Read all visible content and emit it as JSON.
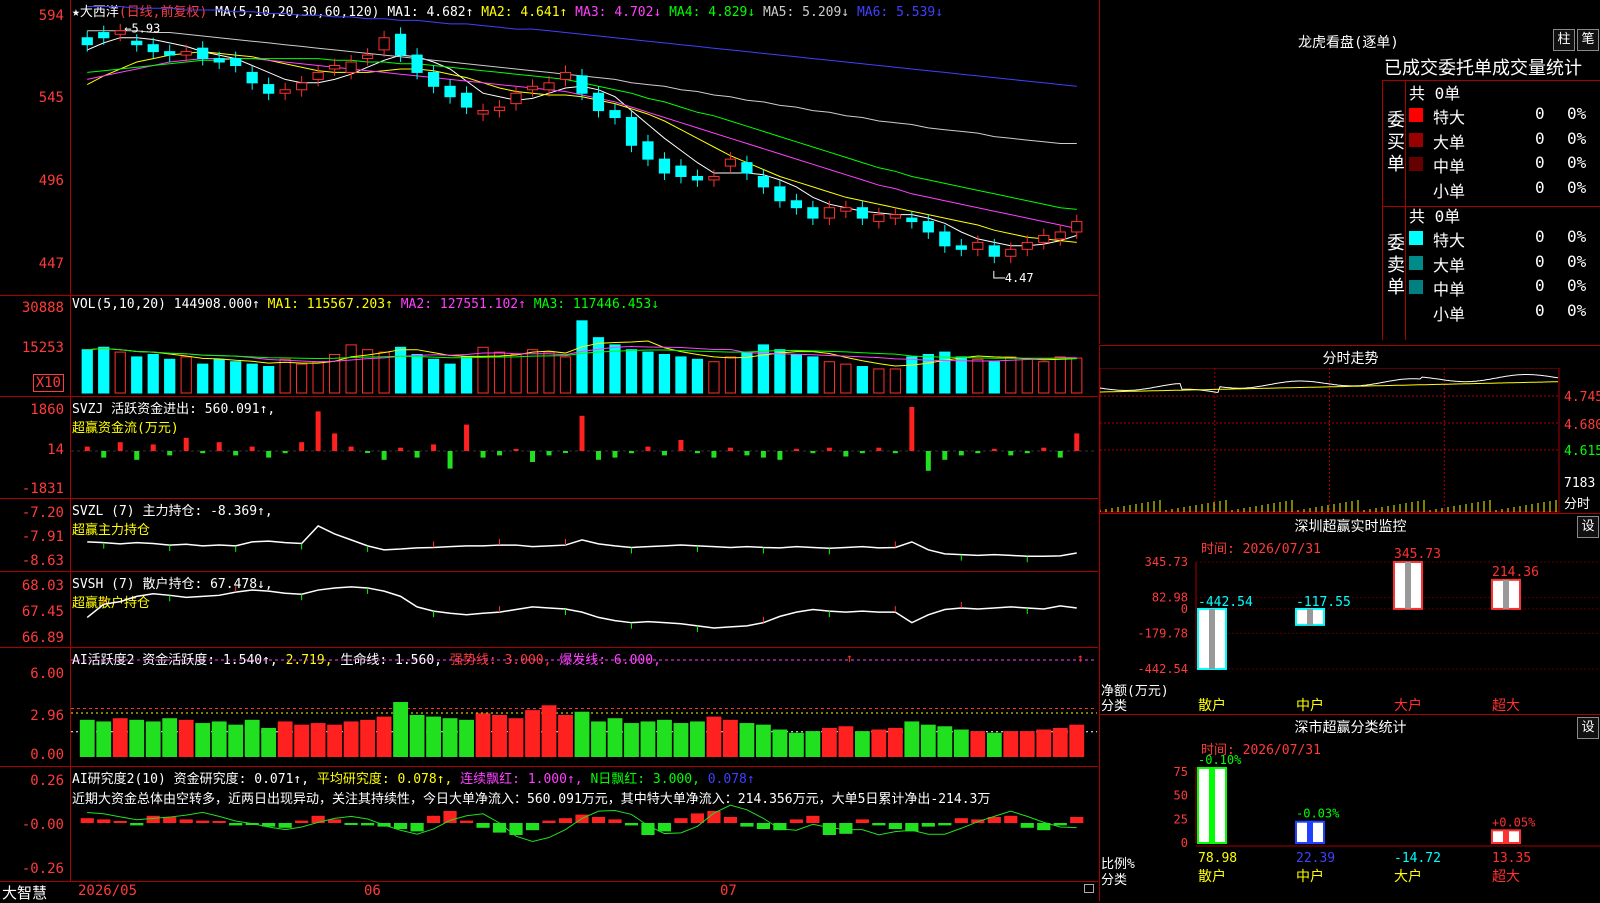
{
  "stock": {
    "name": "★大西洋",
    "period": "(日线,前复权)",
    "ma_label": "MA(5,10,20,30,60,120)",
    "ma_values": [
      {
        "t": "MA1: 4.682↑",
        "c": "#ffffff"
      },
      {
        "t": "MA2: 4.641↑",
        "c": "#ffff00"
      },
      {
        "t": "MA3: 4.702↓",
        "c": "#ff40ff"
      },
      {
        "t": "MA4: 4.829↓",
        "c": "#00ff00"
      },
      {
        "t": "MA5: 5.209↓",
        "c": "#cccccc"
      },
      {
        "t": "MA6: 5.539↓",
        "c": "#4040ff"
      }
    ],
    "high_label": "5.93",
    "low_label": "4.47",
    "axis_ticks": [
      "594",
      "545",
      "496",
      "447"
    ]
  },
  "vol": {
    "label": "VOL(5,10,20)",
    "value": "144908.000↑",
    "ma": [
      {
        "t": "MA1: 115567.203↑",
        "c": "#ffff00"
      },
      {
        "t": "MA2: 127551.102↑",
        "c": "#ff40ff"
      },
      {
        "t": "MA3: 117446.453↓",
        "c": "#00ff00"
      }
    ],
    "axis_ticks": [
      "30888",
      "15253"
    ],
    "unit": "X10"
  },
  "svzj": {
    "line1": "SVZJ  活跃资金进出: 560.091↑,",
    "line2": "超赢资金流(万元)",
    "axis_ticks": [
      "1860",
      "14",
      "-1831"
    ]
  },
  "svzl": {
    "line1": "SVZL (7) 主力持仓: -8.369↑,",
    "line2": "超赢主力持仓",
    "axis_ticks": [
      "-7.20",
      "-7.91",
      "-8.63"
    ]
  },
  "svsh": {
    "line1": "SVSH (7) 散户持仓: 67.478↓,",
    "line2": "超赢散户持仓",
    "axis_ticks": [
      "68.03",
      "67.45",
      "66.89"
    ]
  },
  "ai1": {
    "parts": [
      {
        "t": "AI活跃度2 资金活跃度: 1.540↑,",
        "c": "#ffffff"
      },
      {
        "t": " 2.719,",
        "c": "#ffff00"
      },
      {
        "t": " 生命线: 1.560,",
        "c": "#ffffff"
      },
      {
        "t": " 强势线: 3.000,",
        "c": "#ff3b3b"
      },
      {
        "t": " 爆发线: 6.000,",
        "c": "#ff40ff"
      }
    ],
    "axis_ticks": [
      "6.00",
      "2.96",
      "0.00"
    ]
  },
  "ai2": {
    "parts": [
      {
        "t": "AI研究度2(10) 资金研究度: 0.071↑,",
        "c": "#ffffff"
      },
      {
        "t": " 平均研究度: 0.078↑,",
        "c": "#ffff00"
      },
      {
        "t": " 连续飘红: 1.000↑,",
        "c": "#ff40ff"
      },
      {
        "t": " N日飘红: 3.000,",
        "c": "#00ff00"
      },
      {
        "t": " 0.078↑",
        "c": "#4040ff"
      }
    ],
    "summary": "近期大资金总体由空转多，近两日出现异动，关注其持续性，今日大单净流入：560.091万元，其中特大单净流入：214.356万元，大单5日累计净出-214.3万",
    "axis_ticks": [
      "0.26",
      "-0.00",
      "-0.26"
    ]
  },
  "footer": {
    "brand": "大智慧",
    "dates": [
      "2026/05",
      "06",
      "07"
    ]
  },
  "lhb": {
    "title": "龙虎看盘(逐单)",
    "btn1": "柱",
    "btn2": "笔",
    "header": "已成交委托单成交量统计",
    "buy": {
      "side": "委买单",
      "total": "共 0单",
      "rows": [
        {
          "name": "特大",
          "v": "0",
          "p": "0%",
          "c": "#ff0000"
        },
        {
          "name": "大单",
          "v": "0",
          "p": "0%",
          "c": "#990000"
        },
        {
          "name": "中单",
          "v": "0",
          "p": "0%",
          "c": "#660000"
        },
        {
          "name": "小单",
          "v": "0",
          "p": "0%",
          "c": "#000000"
        }
      ]
    },
    "sell": {
      "side": "委卖单",
      "total": "共 0单",
      "rows": [
        {
          "name": "特大",
          "v": "0",
          "p": "0%",
          "c": "#00ffff"
        },
        {
          "name": "大单",
          "v": "0",
          "p": "0%",
          "c": "#008b8b"
        },
        {
          "name": "中单",
          "v": "0",
          "p": "0%",
          "c": "#008080"
        },
        {
          "name": "小单",
          "v": "0",
          "p": "0%",
          "c": "#000000"
        }
      ]
    }
  },
  "intraday": {
    "title": "分时走势",
    "ticks": [
      "4.745",
      "4.680",
      "4.615"
    ],
    "vol_tick": "7183",
    "unit": "分时"
  },
  "monitor": {
    "title": "深圳超赢实时监控",
    "btn": "设",
    "time": "时间: 2026/07/31",
    "axis_ticks": [
      "345.73",
      "82.98",
      "0",
      "-179.78",
      "-442.54"
    ],
    "unit1": "净额(万元)",
    "unit2": "分类",
    "bars": [
      {
        "cat": "散户",
        "val": -442.54,
        "label": "-442.54",
        "color": "#00ffff",
        "cat_color": "#ffff00",
        "label_color": "#00ffff"
      },
      {
        "cat": "中户",
        "val": -117.55,
        "label": "-117.55",
        "color": "#00ffff",
        "cat_color": "#ffff00",
        "label_color": "#00ffff"
      },
      {
        "cat": "大户",
        "val": 345.73,
        "label": "345.73",
        "color": "#ff3030",
        "cat_color": "#ff3030",
        "label_color": "#ff3030"
      },
      {
        "cat": "超大",
        "val": 214.36,
        "label": "214.36",
        "color": "#ff3030",
        "cat_color": "#ff3030",
        "label_color": "#ff3030"
      }
    ]
  },
  "stats": {
    "title": "深市超赢分类统计",
    "btn": "设",
    "time": "时间: 2026/07/31",
    "axis_ticks": [
      "75",
      "50",
      "25",
      "0"
    ],
    "unit1": "比例%",
    "unit2": "分类",
    "bars": [
      {
        "cat": "散户",
        "val": 78.98,
        "label": "78.98",
        "top": "-0.10%",
        "color": "#00ff00",
        "cat_color": "#ffff00",
        "label_color": "#ffff00",
        "top_color": "#00ff00"
      },
      {
        "cat": "中户",
        "val": 22.39,
        "label": "22.39",
        "top": "-0.03%",
        "color": "#2040ff",
        "cat_color": "#ffff00",
        "label_color": "#4040ff",
        "top_color": "#00ff00"
      },
      {
        "cat": "大户",
        "val": 0,
        "label": "-14.72",
        "top": "",
        "color": "#00ffff",
        "cat_color": "#ffff00",
        "label_color": "#00ffff",
        "top_color": "#00ff00"
      },
      {
        "cat": "超大",
        "val": 13.35,
        "label": "13.35",
        "top": "+0.05%",
        "color": "#ff3030",
        "cat_color": "#ff3030",
        "label_color": "#ff3030",
        "top_color": "#ff3030"
      }
    ]
  },
  "chart_data": {
    "type": "candlestick",
    "title": "大西洋",
    "dates": [
      "2026/05",
      "06",
      "07"
    ],
    "ylim": [
      4.4,
      5.98
    ],
    "open": [
      5.82,
      5.85,
      5.84,
      5.8,
      5.78,
      5.74,
      5.72,
      5.76,
      5.7,
      5.7,
      5.62,
      5.55,
      5.5,
      5.52,
      5.58,
      5.64,
      5.62,
      5.7,
      5.75,
      5.84,
      5.72,
      5.62,
      5.54,
      5.5,
      5.38,
      5.4,
      5.44,
      5.52,
      5.52,
      5.58,
      5.6,
      5.5,
      5.4,
      5.36,
      5.22,
      5.12,
      5.08,
      5.02,
      5.0,
      5.08,
      5.1,
      5.02,
      4.96,
      4.88,
      4.84,
      4.78,
      4.82,
      4.84,
      4.76,
      4.78,
      4.78,
      4.76,
      4.7,
      4.62,
      4.6,
      4.62,
      4.56,
      4.6,
      4.64,
      4.66,
      4.7
    ],
    "close": [
      5.78,
      5.82,
      5.86,
      5.78,
      5.74,
      5.72,
      5.74,
      5.7,
      5.68,
      5.66,
      5.56,
      5.5,
      5.52,
      5.56,
      5.62,
      5.66,
      5.68,
      5.72,
      5.82,
      5.72,
      5.62,
      5.54,
      5.48,
      5.42,
      5.4,
      5.42,
      5.5,
      5.54,
      5.56,
      5.62,
      5.5,
      5.4,
      5.36,
      5.2,
      5.12,
      5.04,
      5.02,
      5.0,
      5.02,
      5.12,
      5.04,
      4.96,
      4.88,
      4.84,
      4.78,
      4.84,
      4.84,
      4.78,
      4.8,
      4.8,
      4.76,
      4.7,
      4.62,
      4.6,
      4.64,
      4.56,
      4.6,
      4.64,
      4.68,
      4.7,
      4.76
    ],
    "series": [
      {
        "name": "MA1",
        "color": "#ffffff",
        "values": [
          5.75,
          5.79,
          5.82,
          5.82,
          5.81,
          5.79,
          5.77,
          5.74,
          5.72,
          5.7,
          5.66,
          5.62,
          5.58,
          5.56,
          5.56,
          5.58,
          5.61,
          5.65,
          5.69,
          5.72,
          5.71,
          5.68,
          5.64,
          5.57,
          5.5,
          5.48,
          5.46,
          5.47,
          5.5,
          5.53,
          5.54,
          5.52,
          5.48,
          5.4,
          5.32,
          5.24,
          5.17,
          5.1,
          5.04,
          5.04,
          5.04,
          5.03,
          5.0,
          4.96,
          4.9,
          4.86,
          4.84,
          4.82,
          4.81,
          4.8,
          4.8,
          4.78,
          4.75,
          4.7,
          4.66,
          4.64,
          4.62,
          4.62,
          4.63,
          4.65,
          4.68
        ]
      },
      {
        "name": "MA2",
        "color": "#ffff00",
        "values": [
          5.55,
          5.6,
          5.64,
          5.68,
          5.7,
          5.72,
          5.73,
          5.74,
          5.73,
          5.72,
          5.71,
          5.69,
          5.67,
          5.65,
          5.63,
          5.62,
          5.62,
          5.62,
          5.63,
          5.64,
          5.64,
          5.63,
          5.61,
          5.59,
          5.56,
          5.53,
          5.51,
          5.5,
          5.49,
          5.49,
          5.48,
          5.46,
          5.44,
          5.41,
          5.38,
          5.34,
          5.29,
          5.24,
          5.19,
          5.14,
          5.1,
          5.06,
          5.02,
          4.99,
          4.96,
          4.93,
          4.9,
          4.88,
          4.86,
          4.84,
          4.82,
          4.8,
          4.78,
          4.76,
          4.74,
          4.71,
          4.69,
          4.67,
          4.66,
          4.65,
          4.64
        ]
      },
      {
        "name": "MA3",
        "color": "#ff40ff",
        "values": [
          5.58,
          5.6,
          5.62,
          5.64,
          5.66,
          5.68,
          5.69,
          5.7,
          5.7,
          5.7,
          5.7,
          5.69,
          5.68,
          5.67,
          5.66,
          5.65,
          5.64,
          5.63,
          5.62,
          5.61,
          5.6,
          5.59,
          5.58,
          5.57,
          5.56,
          5.55,
          5.54,
          5.53,
          5.52,
          5.51,
          5.49,
          5.47,
          5.45,
          5.42,
          5.39,
          5.36,
          5.33,
          5.3,
          5.27,
          5.24,
          5.21,
          5.18,
          5.15,
          5.12,
          5.09,
          5.06,
          5.03,
          5.0,
          4.97,
          4.95,
          4.92,
          4.9,
          4.88,
          4.86,
          4.84,
          4.82,
          4.8,
          4.78,
          4.76,
          4.74,
          4.72
        ]
      },
      {
        "name": "MA4",
        "color": "#00ff00",
        "values": [
          5.62,
          5.63,
          5.64,
          5.65,
          5.66,
          5.67,
          5.68,
          5.69,
          5.69,
          5.7,
          5.7,
          5.7,
          5.7,
          5.7,
          5.7,
          5.69,
          5.69,
          5.68,
          5.68,
          5.67,
          5.67,
          5.66,
          5.65,
          5.64,
          5.63,
          5.62,
          5.61,
          5.6,
          5.59,
          5.58,
          5.56,
          5.54,
          5.52,
          5.5,
          5.47,
          5.45,
          5.42,
          5.39,
          5.37,
          5.34,
          5.31,
          5.28,
          5.25,
          5.22,
          5.19,
          5.16,
          5.13,
          5.1,
          5.07,
          5.05,
          5.02,
          5.0,
          4.98,
          4.96,
          4.94,
          4.92,
          4.9,
          4.88,
          4.86,
          4.84,
          4.83
        ]
      },
      {
        "name": "MA5",
        "color": "#cccccc",
        "values": [
          5.86,
          5.86,
          5.86,
          5.86,
          5.85,
          5.85,
          5.84,
          5.83,
          5.82,
          5.81,
          5.8,
          5.79,
          5.78,
          5.77,
          5.76,
          5.75,
          5.74,
          5.73,
          5.72,
          5.71,
          5.7,
          5.69,
          5.68,
          5.67,
          5.66,
          5.65,
          5.64,
          5.63,
          5.62,
          5.61,
          5.6,
          5.59,
          5.58,
          5.56,
          5.55,
          5.54,
          5.52,
          5.51,
          5.49,
          5.48,
          5.46,
          5.45,
          5.43,
          5.42,
          5.4,
          5.39,
          5.37,
          5.36,
          5.34,
          5.33,
          5.32,
          5.3,
          5.29,
          5.28,
          5.27,
          5.25,
          5.24,
          5.23,
          5.22,
          5.21,
          5.21
        ]
      },
      {
        "name": "MA6",
        "color": "#4040ff",
        "values": [
          6.0,
          6.0,
          6.0,
          5.99,
          5.99,
          5.99,
          5.98,
          5.98,
          5.98,
          5.97,
          5.97,
          5.96,
          5.96,
          5.95,
          5.95,
          5.94,
          5.94,
          5.93,
          5.93,
          5.92,
          5.92,
          5.91,
          5.9,
          5.9,
          5.89,
          5.88,
          5.87,
          5.87,
          5.86,
          5.85,
          5.84,
          5.83,
          5.82,
          5.81,
          5.8,
          5.79,
          5.78,
          5.77,
          5.76,
          5.75,
          5.74,
          5.73,
          5.72,
          5.71,
          5.7,
          5.69,
          5.68,
          5.67,
          5.66,
          5.65,
          5.64,
          5.63,
          5.62,
          5.61,
          5.6,
          5.59,
          5.58,
          5.57,
          5.56,
          5.55,
          5.54
        ]
      }
    ],
    "volume": [
      180,
      190,
      170,
      150,
      160,
      140,
      150,
      120,
      140,
      130,
      120,
      110,
      140,
      120,
      130,
      160,
      200,
      180,
      170,
      190,
      160,
      140,
      120,
      150,
      190,
      170,
      160,
      180,
      170,
      150,
      300,
      230,
      200,
      180,
      170,
      160,
      150,
      140,
      130,
      150,
      170,
      200,
      180,
      160,
      150,
      130,
      120,
      110,
      100,
      100,
      150,
      160,
      170,
      150,
      140,
      130,
      150,
      140,
      130,
      150,
      145
    ],
    "svzj": [
      20,
      -30,
      40,
      -40,
      30,
      -20,
      60,
      -10,
      40,
      -20,
      20,
      -30,
      -10,
      40,
      180,
      80,
      20,
      -5,
      -40,
      15,
      -30,
      30,
      -80,
      120,
      -30,
      -20,
      5,
      -50,
      -20,
      -5,
      160,
      -40,
      -30,
      -10,
      20,
      -20,
      50,
      -10,
      -30,
      15,
      -20,
      -30,
      -40,
      10,
      -10,
      15,
      -25,
      -10,
      15,
      -10,
      200,
      -90,
      -40,
      -20,
      -10,
      10,
      -20,
      -10,
      15,
      -30,
      80
    ],
    "svzl": [
      -8.1,
      -8.12,
      -8.15,
      -8.12,
      -8.14,
      -8.18,
      -8.16,
      -8.2,
      -8.18,
      -8.2,
      -8.1,
      -8.08,
      -8.12,
      -8.14,
      -7.7,
      -7.9,
      -8.05,
      -8.2,
      -8.3,
      -8.28,
      -8.25,
      -8.24,
      -8.22,
      -8.2,
      -8.2,
      -8.18,
      -8.18,
      -8.22,
      -8.2,
      -8.18,
      -8.05,
      -8.15,
      -8.2,
      -8.24,
      -8.22,
      -8.2,
      -8.18,
      -8.2,
      -8.22,
      -8.24,
      -8.22,
      -8.24,
      -8.25,
      -8.22,
      -8.24,
      -8.26,
      -8.24,
      -8.22,
      -8.25,
      -8.24,
      -8.1,
      -8.3,
      -8.4,
      -8.42,
      -8.44,
      -8.42,
      -8.44,
      -8.46,
      -8.46,
      -8.45,
      -8.38
    ],
    "svsh": [
      67.3,
      67.55,
      67.6,
      67.7,
      67.75,
      67.72,
      67.68,
      67.7,
      67.72,
      67.78,
      67.82,
      67.8,
      67.76,
      67.74,
      67.82,
      67.86,
      67.88,
      67.86,
      67.8,
      67.7,
      67.5,
      67.42,
      67.38,
      67.35,
      67.38,
      67.4,
      67.45,
      67.5,
      67.48,
      67.46,
      67.4,
      67.3,
      67.24,
      67.2,
      67.22,
      67.2,
      67.18,
      67.14,
      67.1,
      67.12,
      67.14,
      67.2,
      67.32,
      67.4,
      67.45,
      67.42,
      67.4,
      67.42,
      67.4,
      67.4,
      67.2,
      67.35,
      67.45,
      67.48,
      67.46,
      67.48,
      67.5,
      67.48,
      67.46,
      67.52,
      67.48
    ],
    "ai1": [
      2.3,
      2.2,
      2.4,
      2.3,
      2.2,
      2.4,
      2.3,
      2.1,
      2.2,
      2.0,
      2.3,
      1.8,
      2.2,
      2.0,
      2.1,
      2.0,
      2.2,
      2.3,
      2.5,
      3.4,
      2.6,
      2.5,
      2.4,
      2.3,
      2.7,
      2.6,
      2.4,
      2.9,
      3.2,
      2.6,
      2.8,
      2.2,
      2.4,
      2.1,
      2.2,
      2.3,
      2.1,
      2.2,
      2.5,
      2.3,
      2.1,
      2.0,
      1.7,
      1.5,
      1.6,
      1.8,
      1.9,
      1.6,
      1.7,
      1.8,
      2.2,
      2.0,
      1.9,
      1.7,
      1.6,
      1.5,
      1.6,
      1.6,
      1.7,
      1.8,
      2.0
    ],
    "ai2": [
      0.04,
      0.03,
      0.0,
      -0.02,
      0.06,
      0.05,
      0.03,
      0.02,
      0.0,
      -0.02,
      -0.01,
      -0.03,
      -0.04,
      0.02,
      0.06,
      0.03,
      -0.01,
      -0.02,
      -0.03,
      -0.05,
      -0.07,
      0.06,
      0.1,
      0.02,
      -0.04,
      -0.08,
      -0.1,
      -0.06,
      0.02,
      0.04,
      0.07,
      0.05,
      0.03,
      -0.02,
      -0.1,
      -0.07,
      0.04,
      0.08,
      0.1,
      0.05,
      -0.03,
      -0.05,
      -0.06,
      0.03,
      0.06,
      -0.1,
      -0.09,
      0.03,
      -0.02,
      -0.05,
      -0.07,
      -0.03,
      -0.02,
      0.04,
      0.03,
      0.05,
      0.06,
      -0.04,
      -0.06,
      -0.02,
      0.05
    ]
  }
}
